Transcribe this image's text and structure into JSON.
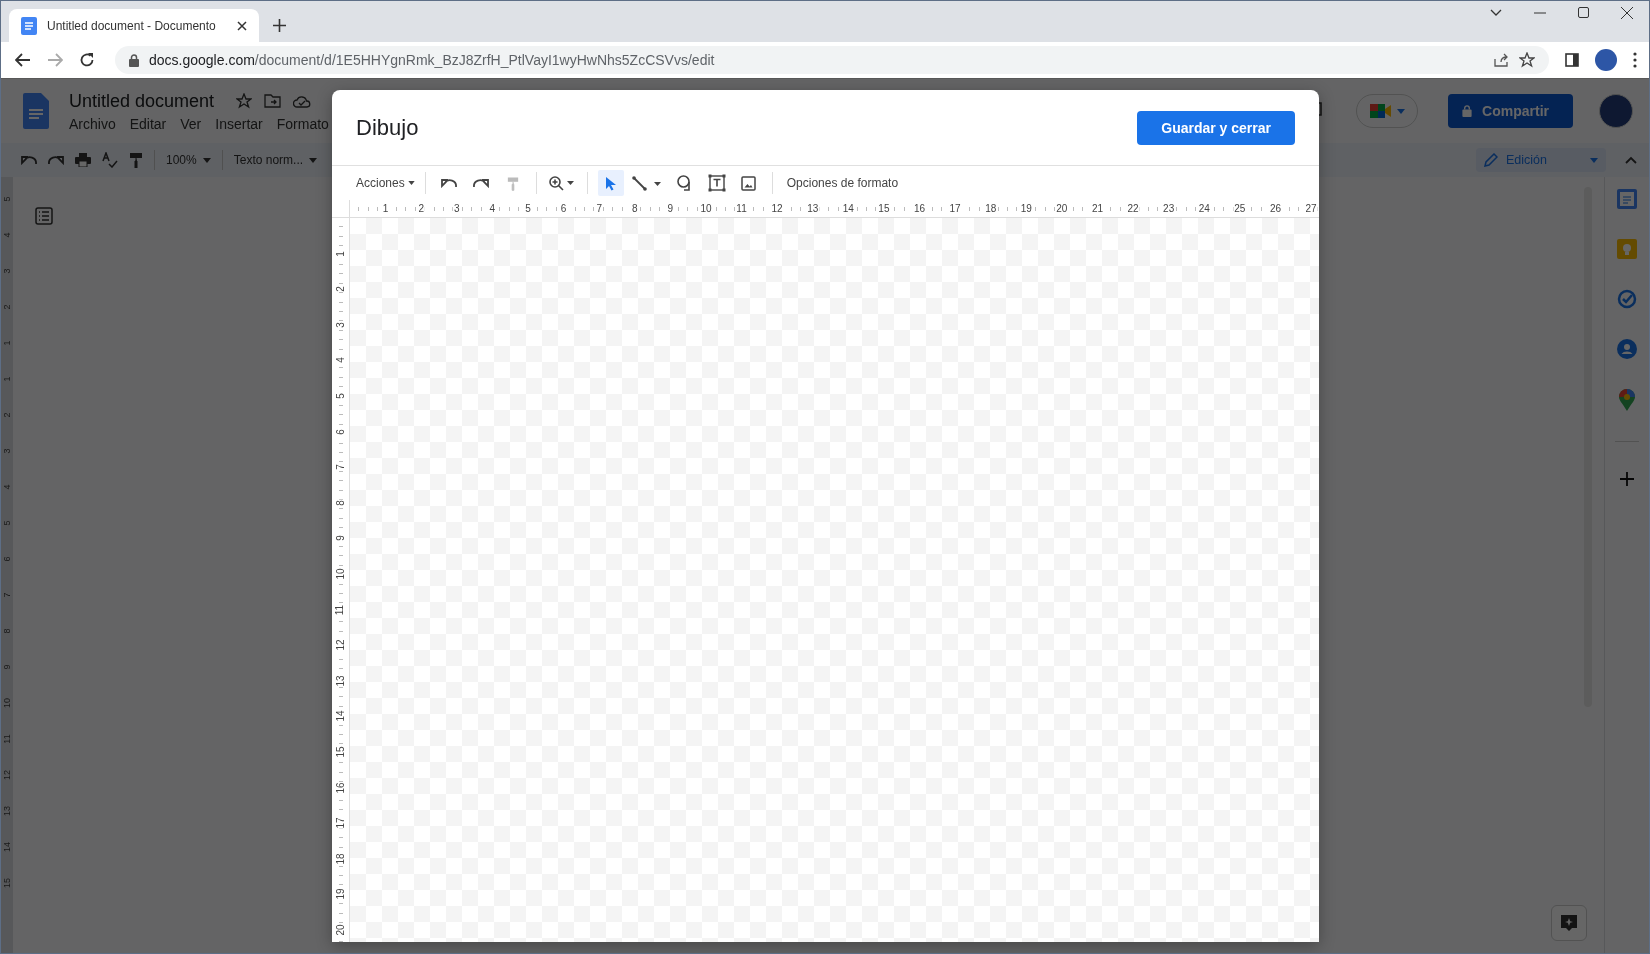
{
  "browser": {
    "tab_title": "Untitled document - Documento",
    "url_host": "docs.google.com",
    "url_path": "/document/d/1E5HHYgnRmk_BzJ8ZrfH_PtlVayI1wyHwNhs5ZcCSVvs/edit"
  },
  "docs": {
    "title": "Untitled document",
    "menus": [
      "Archivo",
      "Editar",
      "Ver",
      "Insertar",
      "Formato"
    ],
    "share_button": "Compartir",
    "zoom": "100%",
    "style": "Texto norm...",
    "mode": "Edición",
    "left_ruler": [
      "5",
      "4",
      "3",
      "2",
      "1",
      "1",
      "2",
      "3",
      "4",
      "5",
      "6",
      "7",
      "8",
      "9",
      "10",
      "11",
      "12",
      "13",
      "14",
      "15"
    ]
  },
  "dialog": {
    "title": "Dibujo",
    "save_button": "Guardar y cerrar",
    "actions_menu": "Acciones",
    "tools": [
      {
        "kind": "undo",
        "disabled": false,
        "selected": false
      },
      {
        "kind": "redo",
        "disabled": false,
        "selected": false
      },
      {
        "kind": "paint",
        "disabled": true,
        "selected": false
      },
      {
        "kind": "sep"
      },
      {
        "kind": "zoom",
        "disabled": false,
        "selected": false
      },
      {
        "kind": "sep"
      },
      {
        "kind": "select",
        "disabled": false,
        "selected": true
      },
      {
        "kind": "line",
        "disabled": false,
        "selected": false
      },
      {
        "kind": "shape",
        "disabled": false,
        "selected": false
      },
      {
        "kind": "textbox",
        "disabled": false,
        "selected": false
      },
      {
        "kind": "image",
        "disabled": false,
        "selected": false
      },
      {
        "kind": "sep"
      }
    ],
    "format_options": "Opciones de formato",
    "h_ruler": [
      "1",
      "2",
      "3",
      "4",
      "5",
      "6",
      "7",
      "8",
      "9",
      "10",
      "11",
      "12",
      "13",
      "14",
      "15",
      "16",
      "17",
      "18",
      "19",
      "20",
      "21",
      "22",
      "23",
      "24",
      "25",
      "26",
      "27"
    ],
    "v_ruler": [
      "1",
      "2",
      "3",
      "4",
      "5",
      "6",
      "7",
      "8",
      "9",
      "10",
      "11",
      "12",
      "13",
      "14",
      "15",
      "16",
      "17",
      "18",
      "19",
      "20"
    ]
  }
}
